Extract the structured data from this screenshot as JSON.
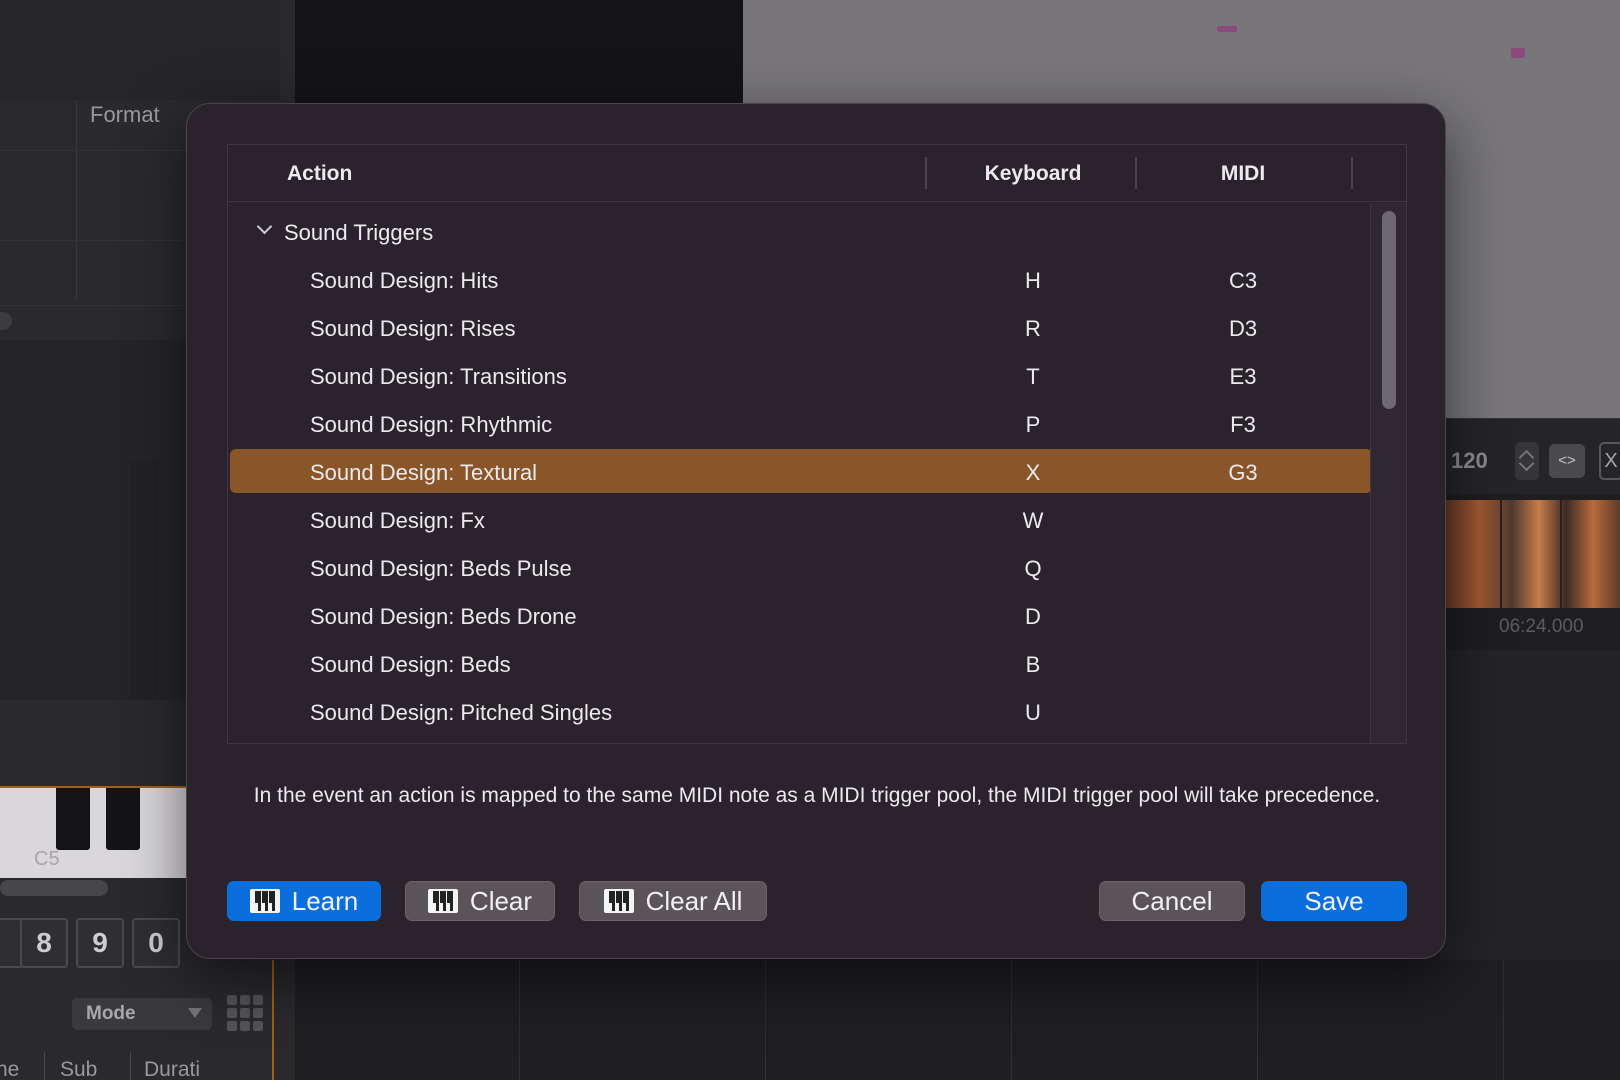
{
  "background": {
    "format_label": "Format",
    "octave_label": "C5",
    "number_keys": [
      "8",
      "9",
      "0"
    ],
    "mode_select": "Mode",
    "columns": [
      "ne",
      "Sub",
      "Durati"
    ],
    "bpm": "120",
    "fit_label": "<>",
    "timecode": "06:24.000"
  },
  "dialog": {
    "table": {
      "headers": {
        "action": "Action",
        "keyboard": "Keyboard",
        "midi": "MIDI"
      },
      "group": "Sound Triggers",
      "rows": [
        {
          "action": "Sound Design: Hits",
          "keyboard": "H",
          "midi": "C3"
        },
        {
          "action": "Sound Design: Rises",
          "keyboard": "R",
          "midi": "D3"
        },
        {
          "action": "Sound Design: Transitions",
          "keyboard": "T",
          "midi": "E3"
        },
        {
          "action": "Sound Design: Rhythmic",
          "keyboard": "P",
          "midi": "F3"
        },
        {
          "action": "Sound Design: Textural",
          "keyboard": "X",
          "midi": "G3"
        },
        {
          "action": "Sound Design: Fx",
          "keyboard": "W",
          "midi": ""
        },
        {
          "action": "Sound Design: Beds Pulse",
          "keyboard": "Q",
          "midi": ""
        },
        {
          "action": "Sound Design: Beds Drone",
          "keyboard": "D",
          "midi": ""
        },
        {
          "action": "Sound Design: Beds",
          "keyboard": "B",
          "midi": ""
        },
        {
          "action": "Sound Design: Pitched Singles",
          "keyboard": "U",
          "midi": ""
        }
      ],
      "selected_index": 4
    },
    "note": "In the event an action is mapped to the same MIDI note as a MIDI trigger pool, the MIDI trigger pool will take precedence.",
    "buttons": {
      "learn": "Learn",
      "clear": "Clear",
      "clear_all": "Clear All",
      "cancel": "Cancel",
      "save": "Save"
    }
  },
  "colors": {
    "selection": "#8a5629",
    "primary_button": "#0a6fdc",
    "dialog_bg": "#2b232b"
  }
}
